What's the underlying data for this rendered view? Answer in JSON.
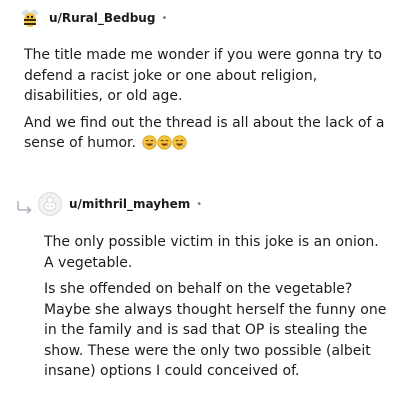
{
  "comments": [
    {
      "username": "u/Rural_Bedbug",
      "separator": "•",
      "paragraphs": [
        "The title made me wonder if you were gonna try to defend a racist joke or one about religion, disabilities, or old age.",
        "And we find out the thread is all about the lack of a sense of humor."
      ],
      "emojis": [
        "laughing-emoji",
        "laughing-emoji",
        "laughing-emoji"
      ]
    },
    {
      "username": "u/mithril_mayhem",
      "separator": "•",
      "paragraphs": [
        "The only possible victim in this joke is an onion. A vegetable.",
        "Is she offended on behalf on the vegetable? Maybe she always thought herself the funny one in the family and is sad that OP is stealing the show. These were the only two possible (albeit insane) options I could conceived of."
      ]
    }
  ],
  "icons": {
    "reply": "reply-arrow-icon",
    "avatar1": "cartoon-bee-avatar",
    "avatar2": "default-snoo-avatar"
  },
  "colors": {
    "text": "#1c1c1c",
    "muted": "#7c7c7c",
    "emoji_yellow": "#f5c33b"
  }
}
